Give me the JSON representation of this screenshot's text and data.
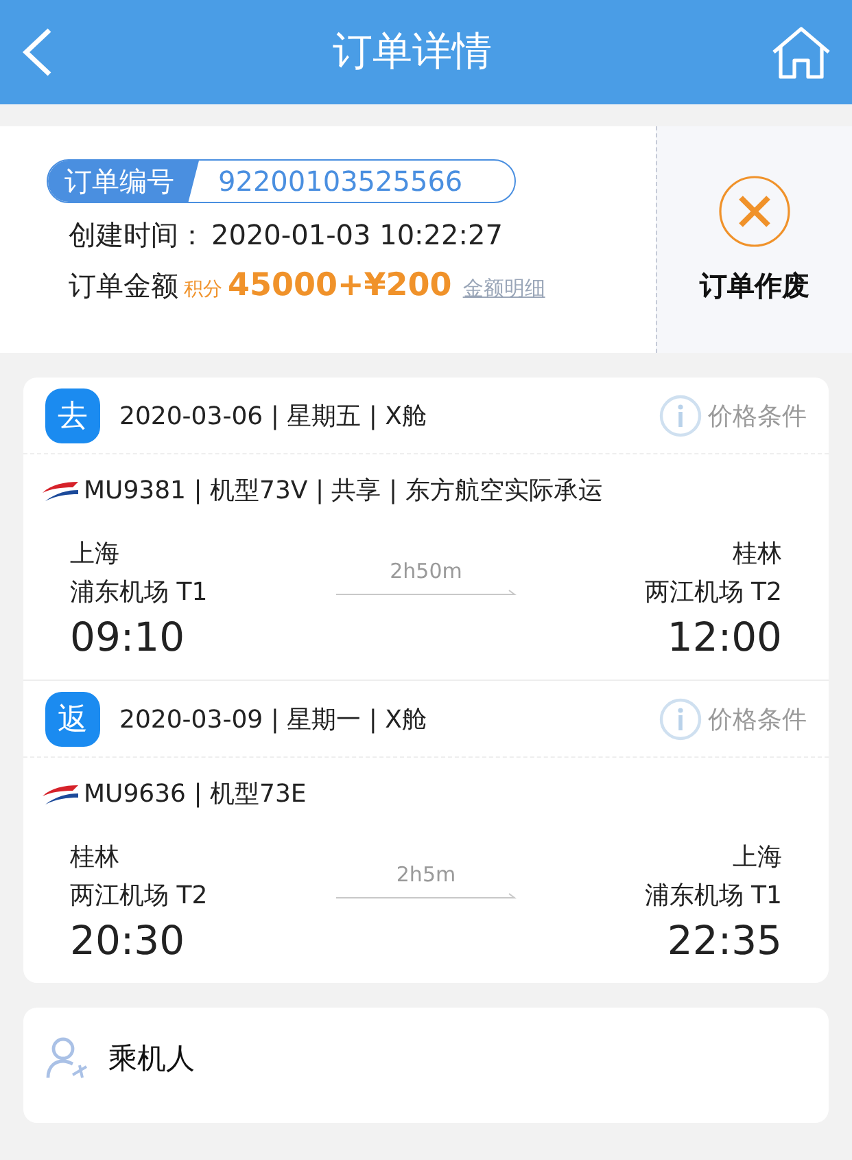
{
  "header": {
    "title": "订单详情"
  },
  "order": {
    "number_label": "订单编号",
    "number": "92200103525566",
    "created_label": "创建时间：",
    "created": "2020-01-03 10:22:27",
    "amount_label": "订单金额",
    "points_label": "积分",
    "amount": "45000+¥200",
    "detail_link": "金额明细",
    "cancel_label": "订单作废"
  },
  "segments": [
    {
      "badge": "去",
      "date": "2020-03-06 | 星期五 | X舱",
      "price_terms": "价格条件",
      "flight": "MU9381 | 机型73V | 共享 | 东方航空实际承运",
      "from_city": "上海",
      "from_airport": "浦东机场 T1",
      "from_time": "09:10",
      "duration": "2h50m",
      "to_city": "桂林",
      "to_airport": "两江机场 T2",
      "to_time": "12:00"
    },
    {
      "badge": "返",
      "date": "2020-03-09 | 星期一 | X舱",
      "price_terms": "价格条件",
      "flight": "MU9636 | 机型73E",
      "from_city": "桂林",
      "from_airport": "两江机场 T2",
      "from_time": "20:30",
      "duration": "2h5m",
      "to_city": "上海",
      "to_airport": "浦东机场 T1",
      "to_time": "22:35"
    }
  ],
  "passengers": {
    "title": "乘机人"
  }
}
